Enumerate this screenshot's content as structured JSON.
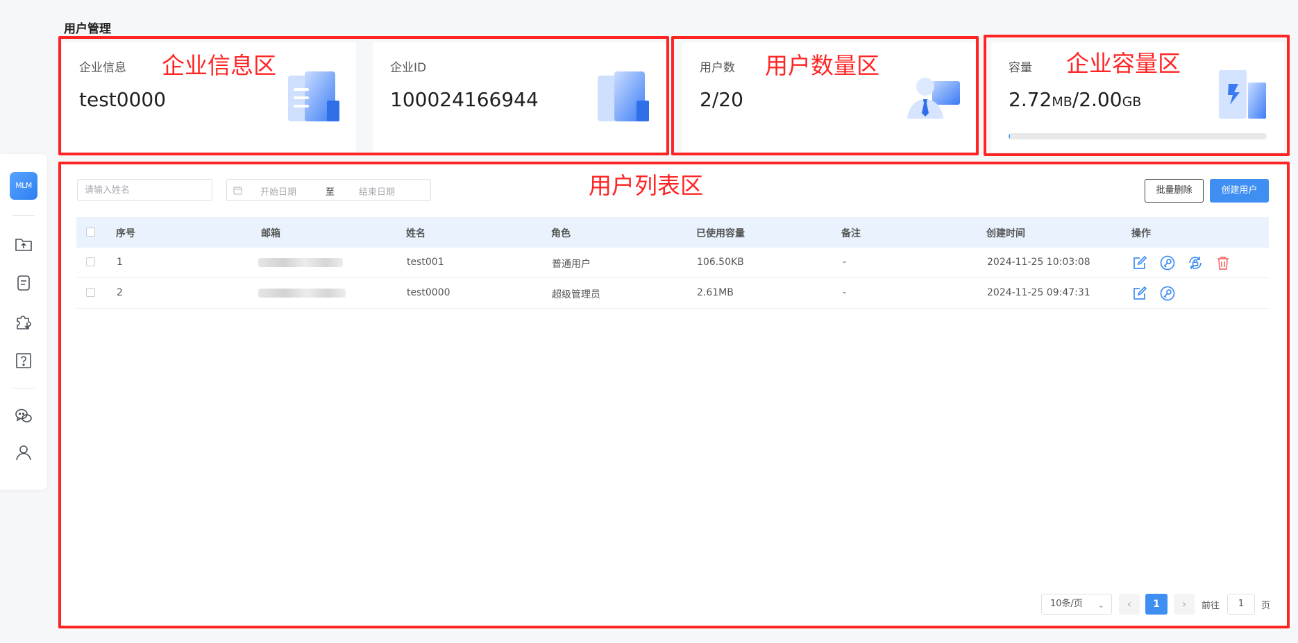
{
  "page_title": "用户管理",
  "sidebar": {
    "logo_text": "MLM",
    "icons": [
      "folder-upload-icon",
      "document-icon",
      "puzzle-download-icon",
      "help-icon",
      "wechat-icon",
      "user-icon"
    ]
  },
  "cards": {
    "enterprise_info": {
      "label": "企业信息",
      "value": "test0000"
    },
    "enterprise_id": {
      "label": "企业ID",
      "value": "100024166944"
    },
    "user_count": {
      "label": "用户数",
      "value": "2/20"
    },
    "capacity": {
      "label": "容量",
      "used": "2.72",
      "used_unit": "MB",
      "separator": "/",
      "total": "2.00",
      "total_unit": "GB",
      "used_fraction": 0.0013
    }
  },
  "annotations": {
    "enterprise_info_area": "企业信息区",
    "user_count_area": "用户数量区",
    "capacity_area": "企业容量区",
    "user_list_area": "用户列表区",
    "color": "#ff2424"
  },
  "filters": {
    "name_placeholder": "请输入姓名",
    "start_placeholder": "开始日期",
    "range_separator": "至",
    "end_placeholder": "结束日期"
  },
  "toolbar": {
    "batch_delete_label": "批量删除",
    "create_user_label": "创建用户"
  },
  "table": {
    "columns": [
      "序号",
      "邮箱",
      "姓名",
      "角色",
      "已使用容量",
      "备注",
      "创建时间",
      "操作"
    ],
    "rows": [
      {
        "index": "1",
        "name": "test001",
        "role": "普通用户",
        "used": "106.50KB",
        "remark": "-",
        "created": "2024-11-25 10:03:08",
        "actions": [
          "edit-icon",
          "key-icon",
          "unlock-icon",
          "trash-icon"
        ]
      },
      {
        "index": "2",
        "name": "test0000",
        "role": "超级管理员",
        "used": "2.61MB",
        "remark": "-",
        "created": "2024-11-25 09:47:31",
        "actions": [
          "edit-icon",
          "key-icon"
        ]
      }
    ]
  },
  "pagination": {
    "page_size": "10条/页",
    "current_page": "1",
    "goto_prefix": "前往",
    "goto_value": "1",
    "goto_suffix": "页"
  },
  "colors": {
    "accent": "#3f8ff2",
    "danger": "#f56c6c",
    "header_bg": "#e9f2fd"
  }
}
